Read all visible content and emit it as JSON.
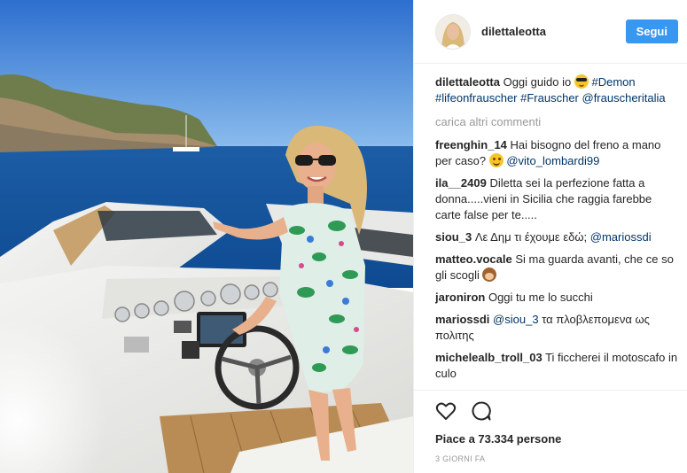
{
  "post": {
    "username": "dilettaleotta",
    "follow_label": "Segui",
    "caption": {
      "username": "dilettaleotta",
      "text": "Oggi guido io",
      "emoji": "sunglasses-emoji",
      "tag1": "#Demon",
      "tag2": "#lifeonfrauscher",
      "tag3": "#Frauscher",
      "mention": "@frauscheritalia"
    },
    "load_more": "carica altri commenti",
    "comments": [
      {
        "user": "freenghin_14",
        "text": "Hai bisogno del freno a mano per caso?",
        "emoji": "wink-emoji",
        "mention": "@vito_lombardi99"
      },
      {
        "user": "ila__2409",
        "text": "Diletta sei la perfezione fatta a donna.....vieni in Sicilia che raggia farebbe carte false per te....."
      },
      {
        "user": "siou_3",
        "text": "Λε Δημ τι έχουμε εδώ;",
        "mention": "@mariossdi"
      },
      {
        "user": "matteo.vocale",
        "text": "Si ma guarda avanti, che ce so gli scogli",
        "emoji": "monkey-emoji"
      },
      {
        "user": "jaroniron",
        "text": "Oggi tu me lo succhi"
      },
      {
        "user": "mariossdi",
        "mention": "@siou_3",
        "text": "τα πλοβλεπομενα ως πολιτης"
      },
      {
        "user": "michelealb_troll_03",
        "text": "Ti ficcherei il motoscafo in culo"
      }
    ],
    "likes": "Piace a 73.334 persone",
    "time_ago": "3 GIORNI FA"
  },
  "icons": {
    "like": "heart-icon",
    "comment": "comment-icon"
  },
  "colors": {
    "follow": "#3897f0",
    "link": "#003569",
    "muted": "#999999"
  }
}
